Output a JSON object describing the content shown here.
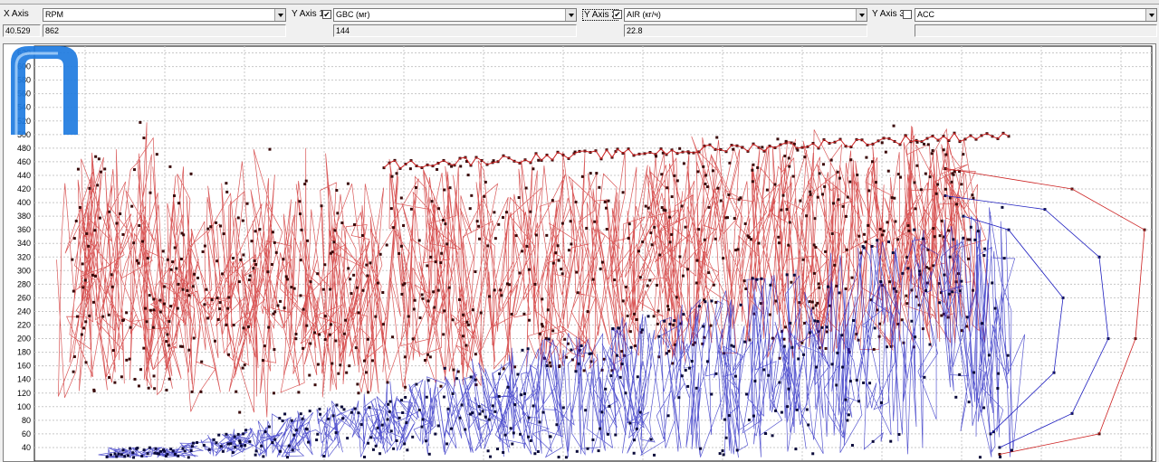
{
  "header": {
    "x_axis_label": "X Axis",
    "x_axis_select": "RPM",
    "x_value": "40.529",
    "x_axis_current": "862",
    "y1_label": "Y Axis 1",
    "y1_checked": "✔",
    "y1_select": "GBC (мг)",
    "y1_current": "144",
    "y2_label": "Y Axis 2",
    "y2_checked": "✔",
    "y2_select": "AIR (кг/ч)",
    "y2_current": "22.8",
    "y3_label": "Y Axis 3",
    "y3_checked": "",
    "y3_select": "ACC",
    "y3_current": ""
  },
  "chart_data": {
    "type": "line",
    "y_ticks": [
      40,
      60,
      80,
      100,
      120,
      140,
      160,
      180,
      200,
      220,
      240,
      260,
      280,
      300,
      320,
      340,
      360,
      380,
      400,
      420,
      440,
      460,
      480,
      500,
      520,
      540,
      560,
      580,
      600,
      620
    ],
    "ylim": [
      20,
      630
    ],
    "grid": true,
    "series": [
      {
        "color": "#cc2020",
        "values": []
      },
      {
        "color": "#2020c0",
        "values": []
      }
    ]
  },
  "colors": {
    "red_series": "#cc2020",
    "red_marker": "#3a0a0a",
    "blue_series": "#2020c0",
    "blue_marker": "#0a0a3a",
    "logo": "#1e7be0"
  }
}
